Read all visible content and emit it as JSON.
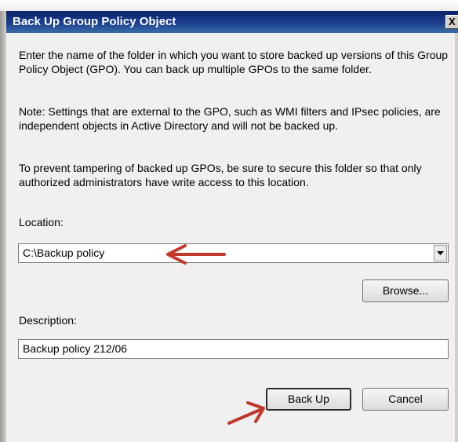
{
  "dialog": {
    "title": "Back Up Group Policy Object",
    "close_label": "X",
    "intro": "Enter the name of the folder in which you want to store backed up versions of this Group Policy Object (GPO). You can back up multiple GPOs to the same folder.",
    "note": "Note: Settings that are external to the GPO, such as WMI filters and IPsec policies, are independent objects in Active Directory and will not be backed up.",
    "warning": "To prevent tampering of backed up GPOs, be sure to secure this folder so that only authorized administrators have write access to this location."
  },
  "location": {
    "label": "Location:",
    "value": "C:\\Backup policy"
  },
  "browse": {
    "label": "Browse..."
  },
  "description": {
    "label": "Description:",
    "value": "Backup policy 212/06"
  },
  "buttons": {
    "backup": "Back Up",
    "cancel": "Cancel"
  },
  "annotation": {
    "arrow_color": "#c0392b"
  }
}
